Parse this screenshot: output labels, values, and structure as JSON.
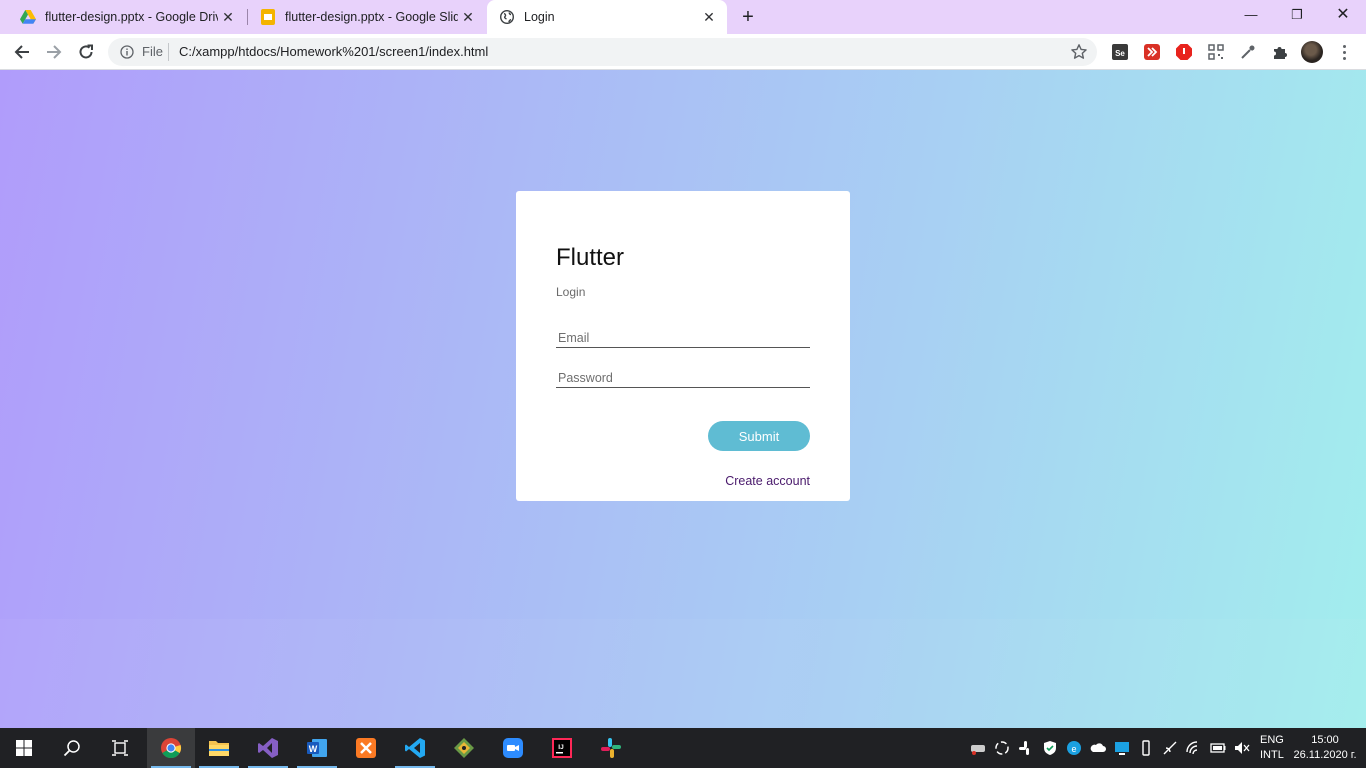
{
  "browser": {
    "tabs": [
      {
        "title": "flutter-design.pptx - Google Drive",
        "favicon": "google-drive-icon",
        "active": false
      },
      {
        "title": "flutter-design.pptx - Google Slides",
        "favicon": "google-slides-icon",
        "active": false
      },
      {
        "title": "Login",
        "favicon": "globe-icon",
        "active": true
      }
    ],
    "omnibox": {
      "scheme_label": "File",
      "url": "C:/xampp/htdocs/Homework%201/screen1/index.html"
    },
    "extensions": [
      "selenium-ide-icon",
      "red-arrow-extension-icon",
      "adblock-icon",
      "qr-code-icon",
      "eyedropper-icon",
      "puzzle-extensions-icon"
    ]
  },
  "login_card": {
    "title": "Flutter",
    "subtitle": "Login",
    "email_placeholder": "Email",
    "password_placeholder": "Password",
    "submit_label": "Submit",
    "create_account_label": "Create account"
  },
  "colors": {
    "gradient_start": "#b09cfb",
    "gradient_end": "#a2eeed",
    "submit_button": "#5fbcd3",
    "create_account_link": "#4a1a6c",
    "tab_strip": "#e8d2fb"
  },
  "taskbar": {
    "apps": [
      "start-windows-icon",
      "search-icon",
      "task-view-icon",
      "chrome-icon",
      "file-explorer-icon",
      "visual-studio-icon",
      "word-icon",
      "xampp-icon",
      "vscode-icon",
      "git-kraken-icon",
      "zoom-icon",
      "intellij-icon",
      "slack-icon"
    ],
    "tray": {
      "language_top": "ENG",
      "language_bottom": "INTL",
      "time": "15:00",
      "date": "26.11.2020 г."
    }
  }
}
